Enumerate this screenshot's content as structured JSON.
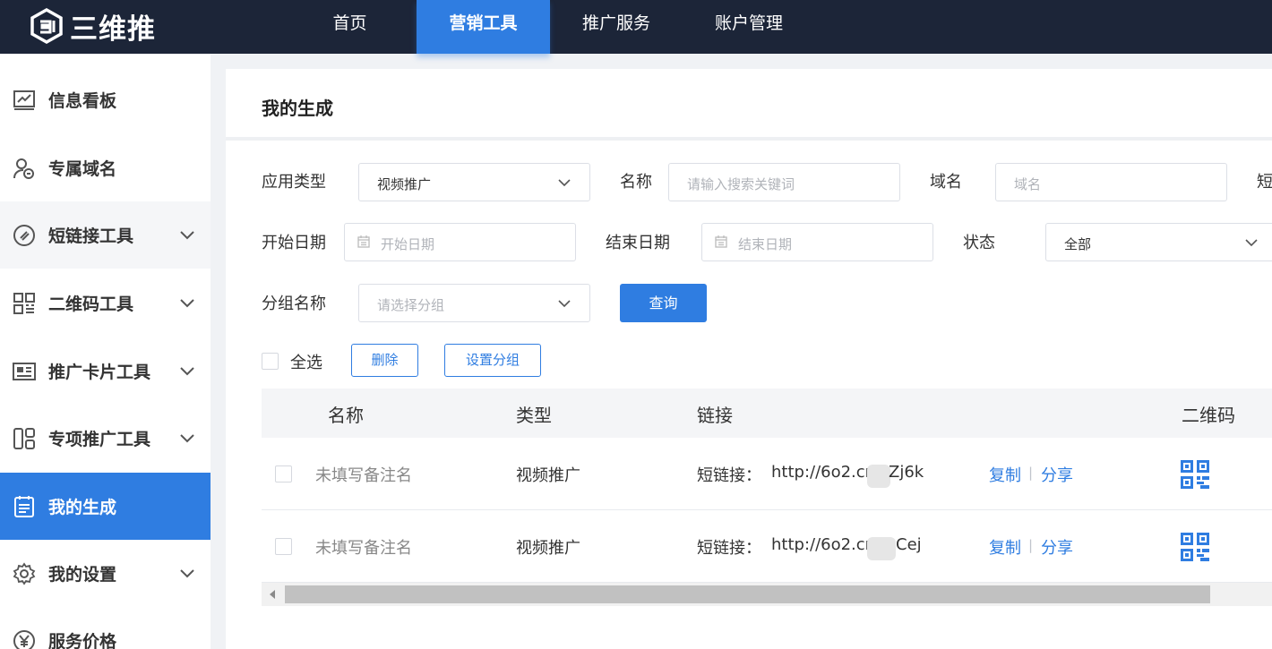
{
  "app": {
    "name": "三维推"
  },
  "topnav": {
    "items": [
      {
        "label": "首页"
      },
      {
        "label": "营销工具"
      },
      {
        "label": "推广服务"
      },
      {
        "label": "账户管理"
      }
    ]
  },
  "sidebar": {
    "items": [
      {
        "label": "信息看板",
        "icon": "chart-board-icon"
      },
      {
        "label": "专属域名",
        "icon": "user-link-icon"
      },
      {
        "label": "短链接工具",
        "icon": "link-clip-icon"
      },
      {
        "label": "二维码工具",
        "icon": "qrcode-icon"
      },
      {
        "label": "推广卡片工具",
        "icon": "card-icon"
      },
      {
        "label": "专项推广工具",
        "icon": "layout-icon"
      },
      {
        "label": "我的生成",
        "icon": "list-doc-icon"
      },
      {
        "label": "我的设置",
        "icon": "gear-icon"
      },
      {
        "label": "服务价格",
        "icon": "yen-icon"
      }
    ]
  },
  "page": {
    "title": "我的生成"
  },
  "filters": {
    "app_type": {
      "label": "应用类型",
      "value": "视频推广"
    },
    "name": {
      "label": "名称",
      "placeholder": "请输入搜索关键词"
    },
    "domain": {
      "label": "域名",
      "placeholder": "域名"
    },
    "short_label": "短",
    "start_date": {
      "label": "开始日期",
      "placeholder": "开始日期"
    },
    "end_date": {
      "label": "结束日期",
      "placeholder": "结束日期"
    },
    "status": {
      "label": "状态",
      "value": "全部"
    },
    "group": {
      "label": "分组名称",
      "placeholder": "请选择分组"
    },
    "query_button": "查询"
  },
  "bulk": {
    "select_all": "全选",
    "delete_button": "删除",
    "set_group_button": "设置分组"
  },
  "table": {
    "columns": [
      "名称",
      "类型",
      "链接",
      "二维码"
    ],
    "rows": [
      {
        "name": "未填写备注名",
        "type": "视频推广",
        "link_label": "短链接：",
        "link_prefix": "http://6o2.cn/",
        "link_suffix": "Zj6k",
        "copy": "复制",
        "share": "分享"
      },
      {
        "name": "未填写备注名",
        "type": "视频推广",
        "link_label": "短链接：",
        "link_prefix": "http://6o2.cn/",
        "link_suffix": "Cej",
        "copy": "复制",
        "share": "分享"
      }
    ]
  },
  "colors": {
    "accent": "#2f7de1",
    "topbar": "#1c2538"
  }
}
